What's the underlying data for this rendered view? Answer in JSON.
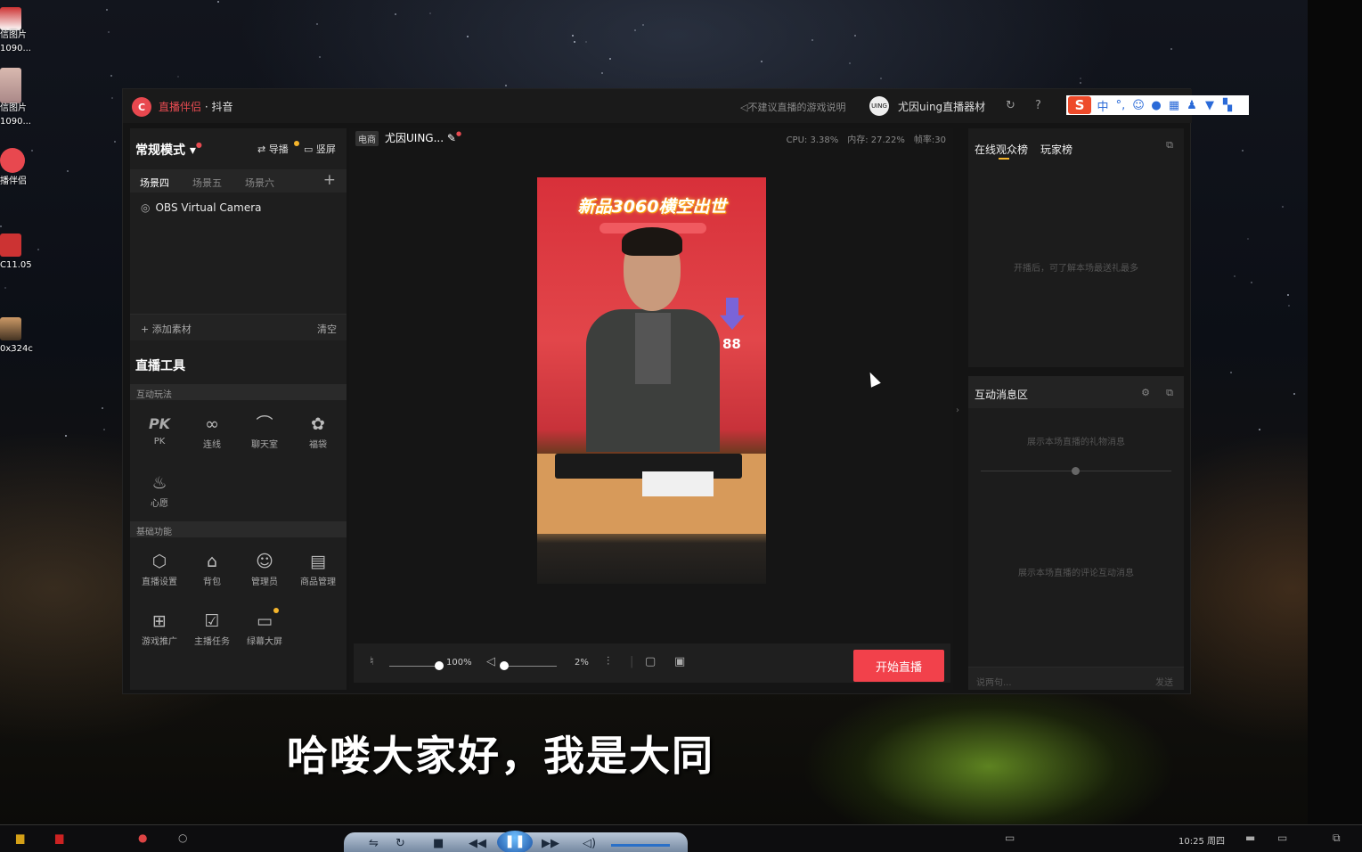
{
  "desktop": {
    "icons": [
      {
        "label": "信图片\n1090..."
      },
      {
        "label": "信图片\n1090..."
      },
      {
        "label": "播伴侣"
      },
      {
        "label": "C11.05"
      },
      {
        "label": "0x324c"
      }
    ]
  },
  "window": {
    "app_name": "直播伴侣",
    "separator": " · ",
    "platform": "抖音",
    "note": "不建议直播的游戏说明",
    "user_name": "尤因uing直播器材",
    "ime_label": "中"
  },
  "left_panel": {
    "mode_title": "常规模式",
    "guide_label": "导播",
    "portrait_label": "竖屏",
    "scene_tabs": [
      "场景四",
      "场景五",
      "场景六"
    ],
    "sources": [
      "OBS Virtual Camera"
    ],
    "add_material": "添加素材",
    "clear": "清空",
    "tools_title": "直播工具",
    "section_interactive": "互动玩法",
    "interactive_tools": [
      {
        "label": "PK",
        "icon": "pk-icon"
      },
      {
        "label": "连线",
        "icon": "link-icon"
      },
      {
        "label": "聊天室",
        "icon": "chatroom-icon"
      },
      {
        "label": "福袋",
        "icon": "lucky-bag-icon"
      },
      {
        "label": "心愿",
        "icon": "wish-icon"
      }
    ],
    "section_basic": "基础功能",
    "basic_tools": [
      {
        "label": "直播设置",
        "icon": "settings-icon"
      },
      {
        "label": "背包",
        "icon": "backpack-icon"
      },
      {
        "label": "管理员",
        "icon": "admin-icon"
      },
      {
        "label": "商品管理",
        "icon": "store-icon"
      },
      {
        "label": "游戏推广",
        "icon": "gamepad-icon"
      },
      {
        "label": "主播任务",
        "icon": "task-icon"
      },
      {
        "label": "绿幕大屏",
        "icon": "screen-icon"
      }
    ]
  },
  "center": {
    "channel_tag": "电商",
    "channel_name": "尤因UING...",
    "cpu": "CPU: 3.38%",
    "memory": "内存: 27.22%",
    "fps": "帧率:30",
    "preview_banner": "新品3060横空出世",
    "preview_price": "88",
    "mic_volume": "100%",
    "speaker_volume": "2%",
    "mic_level": 1.0,
    "speaker_level": 0.02,
    "go_live": "开始直播"
  },
  "right_panel": {
    "tab_online": "在线观众榜",
    "tab_players": "玩家榜",
    "online_hint": "开播后，可了解本场最送礼最多",
    "messages_title": "互动消息区",
    "gift_hint": "展示本场直播的礼物消息",
    "comment_hint": "展示本场直播的评论互动消息",
    "input_placeholder": "说两句...",
    "send": "发送"
  },
  "subtitle": "哈喽大家好，我是大同",
  "taskbar": {
    "clock": "10:25 周四"
  },
  "colors": {
    "accent": "#f2414b",
    "badge": "#f5b52c",
    "panel": "#1e1e1e"
  }
}
